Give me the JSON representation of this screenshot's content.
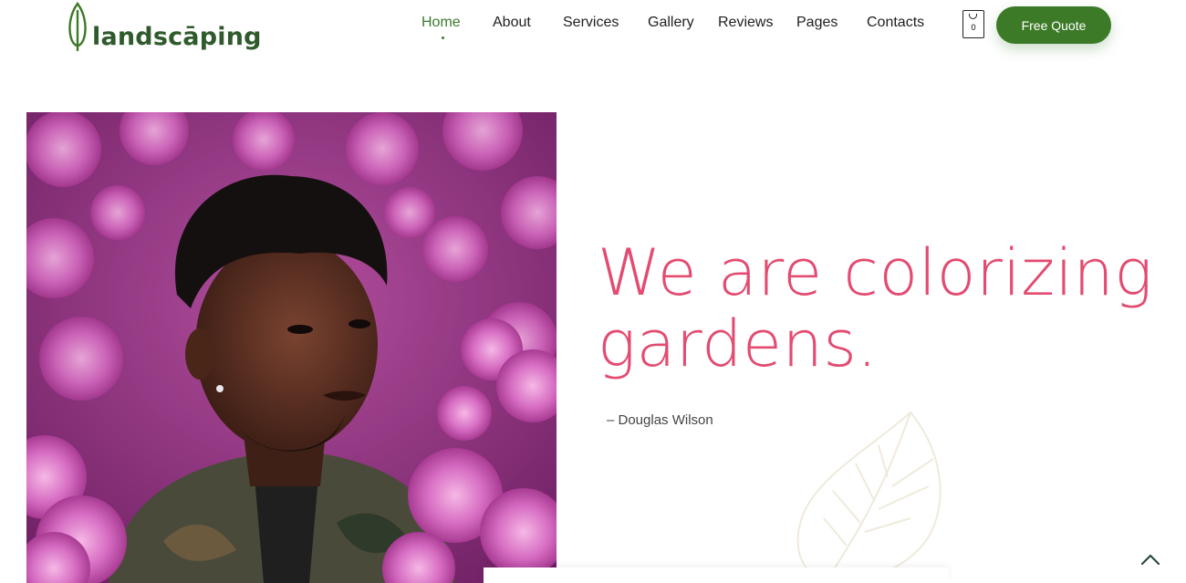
{
  "brand": {
    "name": "landscāping",
    "color": "#2f5a2c"
  },
  "nav": {
    "items": [
      {
        "label": "Home",
        "active": true
      },
      {
        "label": "About",
        "active": false
      },
      {
        "label": "Services",
        "active": false
      },
      {
        "label": "Gallery",
        "active": false
      },
      {
        "label": "Reviews",
        "active": false
      },
      {
        "label": "Pages",
        "active": false
      },
      {
        "label": "Contacts",
        "active": false
      }
    ],
    "active_color": "#3a7a2c"
  },
  "cart": {
    "count": "0",
    "icon": "shopping-bag-icon"
  },
  "cta": {
    "label": "Free Quote",
    "color": "#3d7a28"
  },
  "hero": {
    "headline_line1": "We are colorizing",
    "headline_line2": "gardens.",
    "author": "– Douglas Wilson",
    "headline_color": "#e34b70",
    "image": "portrait-with-pink-flowers"
  },
  "scroll_top": {
    "icon": "chevron-up-icon"
  }
}
